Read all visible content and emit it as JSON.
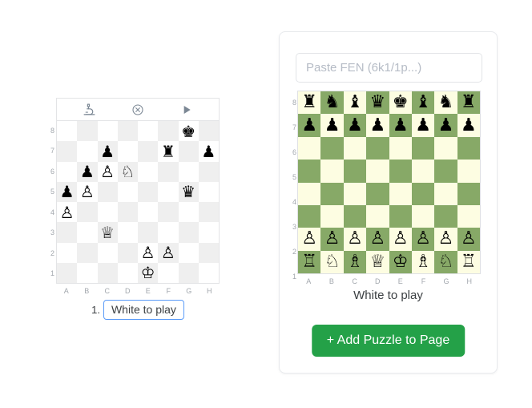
{
  "left_widget": {
    "toolbar": [
      {
        "name": "analysis-microscope-icon",
        "label": "Analysis"
      },
      {
        "name": "clear-board-icon",
        "label": "Clear"
      },
      {
        "name": "play-icon",
        "label": "Play"
      }
    ],
    "board": {
      "light_square_color": "#ffffff",
      "dark_square_color": "#efefef",
      "files": [
        "A",
        "B",
        "C",
        "D",
        "E",
        "F",
        "G",
        "H"
      ],
      "ranks": [
        "8",
        "7",
        "6",
        "5",
        "4",
        "3",
        "2",
        "1"
      ],
      "position": [
        [
          "",
          "",
          "",
          "",
          "",
          "",
          "k",
          ""
        ],
        [
          "",
          "",
          "p",
          "",
          "",
          "r",
          "",
          "p"
        ],
        [
          "",
          "p",
          "P",
          "N",
          "",
          "",
          "",
          ""
        ],
        [
          "p",
          "P",
          "",
          "",
          "",
          "",
          "q",
          ""
        ],
        [
          "P",
          "",
          "",
          "",
          "",
          "",
          "",
          ""
        ],
        [
          "",
          "",
          "Q",
          "",
          "",
          "",
          "",
          ""
        ],
        [
          "",
          "",
          "",
          "",
          "P",
          "P",
          "",
          ""
        ],
        [
          "",
          "",
          "",
          "",
          "K",
          "",
          "",
          ""
        ]
      ]
    },
    "move_number": "1.",
    "move_text": "White to play"
  },
  "right_panel": {
    "fen_placeholder": "Paste FEN (6k1/1p...)",
    "fen_value": "",
    "board": {
      "light_square_color": "#fdfde2",
      "dark_square_color": "#87a967",
      "files": [
        "A",
        "B",
        "C",
        "D",
        "E",
        "F",
        "G",
        "H"
      ],
      "ranks": [
        "8",
        "7",
        "6",
        "5",
        "4",
        "3",
        "2",
        "1"
      ],
      "position": [
        [
          "r",
          "n",
          "b",
          "q",
          "k",
          "b",
          "n",
          "r"
        ],
        [
          "p",
          "p",
          "p",
          "p",
          "p",
          "p",
          "p",
          "p"
        ],
        [
          "",
          "",
          "",
          "",
          "",
          "",
          "",
          ""
        ],
        [
          "",
          "",
          "",
          "",
          "",
          "",
          "",
          ""
        ],
        [
          "",
          "",
          "",
          "",
          "",
          "",
          "",
          ""
        ],
        [
          "",
          "",
          "",
          "",
          "",
          "",
          "",
          ""
        ],
        [
          "P",
          "P",
          "P",
          "P",
          "P",
          "P",
          "P",
          "P"
        ],
        [
          "R",
          "N",
          "B",
          "Q",
          "K",
          "B",
          "N",
          "R"
        ]
      ]
    },
    "turn_text": "White to play",
    "add_button_label": "+ Add Puzzle to Page",
    "add_button_color": "#24a148"
  }
}
